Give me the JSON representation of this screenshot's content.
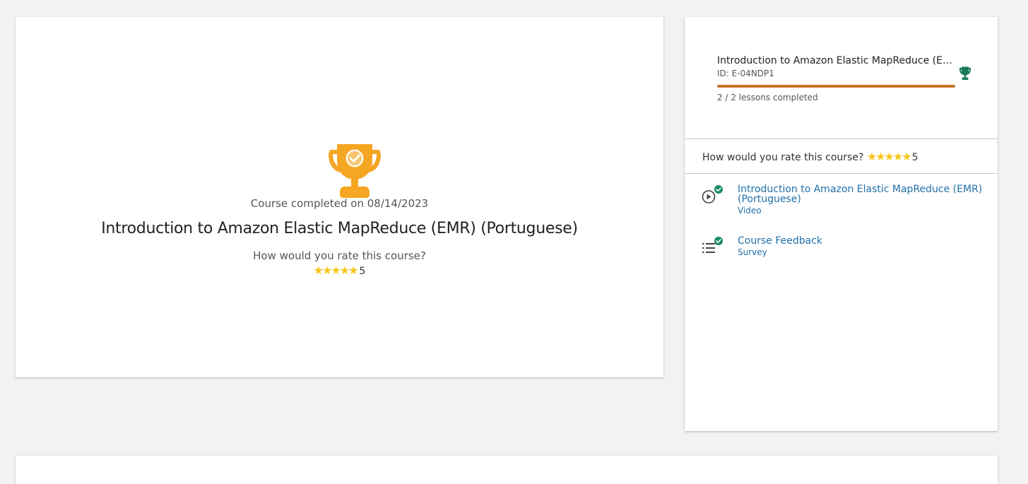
{
  "main": {
    "completed_text": "Course completed on 08/14/2023",
    "course_title": "Introduction to Amazon Elastic MapReduce (EMR) (Portuguese)",
    "rate_question": "How would you rate this course?",
    "rating_value": "5",
    "rating_stars": 5,
    "trophy_icon": "trophy-check-icon",
    "trophy_color": "#f5a623"
  },
  "sidebar": {
    "course_title": "Introduction to Amazon Elastic MapReduce (EMR) (Portuguese)",
    "course_id": "ID: E-04NDP1",
    "progress_fraction": 1.0,
    "progress_color": "#c8742a",
    "lessons_completed": "2 / 2 lessons completed",
    "trophy_icon": "trophy-icon",
    "trophy_color": "#1a7a5a",
    "rate_question": "How would you rate this course?",
    "rating_value": "5",
    "lessons": [
      {
        "title": "Introduction to Amazon Elastic MapReduce (EMR) (Portuguese)",
        "type": "Video",
        "icon": "play-circle-icon",
        "status_icon": "check-circle-icon"
      },
      {
        "title": "Course Feedback",
        "type": "Survey",
        "icon": "list-icon",
        "status_icon": "check-circle-icon"
      }
    ],
    "link_color": "#1f6fa8",
    "check_color": "#1a8a6a"
  }
}
